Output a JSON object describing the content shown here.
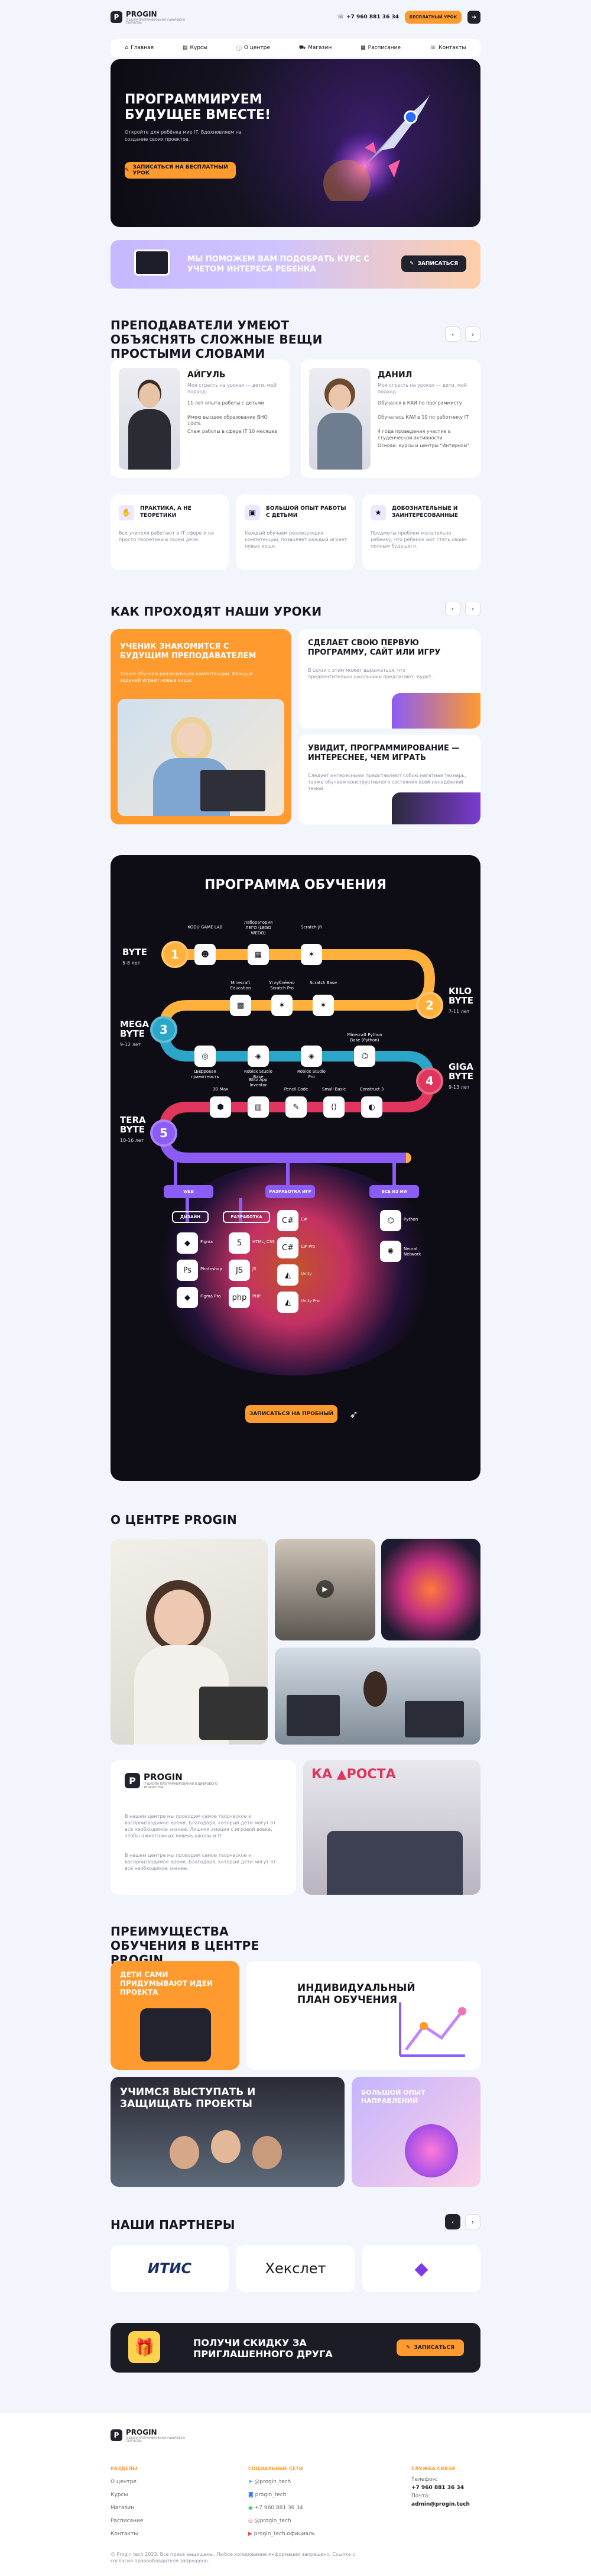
{
  "header": {
    "logo_text": "PROGIN",
    "logo_sub": "IT-ШКОЛА ПРОГРАММИРОВАНИЯ И ЦИФРОВОГО ТВОРЧЕСТВА",
    "phone": "+7 960 881 36 34",
    "cta": "БЕСПЛАТНЫЙ УРОК"
  },
  "nav": {
    "items": [
      "Главная",
      "Курсы",
      "О центре",
      "Магазин",
      "Расписание",
      "Контакты"
    ]
  },
  "hero": {
    "title": "ПРОГРАММИРУЕМ БУДУЩЕЕ ВМЕСТЕ!",
    "subtitle": "Откройте для ребёнка мир IT. Вдохновляем на создание своих проектов.",
    "button": "ЗАПИСАТЬСЯ НА БЕСПЛАТНЫЙ УРОК"
  },
  "course_banner": {
    "text": "МЫ ПОМОЖЕМ ВАМ ПОДОБРАТЬ КУРС С УЧЕТОМ ИНТЕРЕСА РЕБЕНКА",
    "button": "ЗАПИСАТЬСЯ"
  },
  "teachers": {
    "title": "ПРЕПОДАВАТЕЛИ УМЕЮТ ОБЪЯСНЯТЬ СЛОЖНЫЕ ВЕЩИ ПРОСТЫМИ СЛОВАМИ",
    "list": [
      {
        "name": "АЙГУЛЬ",
        "role": "Моя страсть на уроках — дети, мой подход:",
        "facts": [
          "11 лет опыта работы с детьми",
          "Имею высшее образование ВНО 100%",
          "Стаж работы в сфере IT 10 месяцев"
        ]
      },
      {
        "name": "ДАНИЛ",
        "role": "Моя страсть на уроках — дети, мой подход:",
        "facts": [
          "Обучался в КАИ по программисту",
          "Обучалась КАИ в 10 по работнику IT",
          "4 года проведения участие в студенческой активности",
          "Основа: курсы и центры \"Интерном\""
        ]
      }
    ],
    "features": [
      {
        "title": "ПРАКТИКА, А НЕ ТЕОРЕТИКИ",
        "text": "Все учителя работают в IT сфере и не просто теоретики в своем деле."
      },
      {
        "title": "БОЛЬШОЙ ОПЫТ РАБОТЫ С ДЕТЬМИ",
        "text": "Каждый обучаем реализующие компетенции, позволяет каждый играет новые вещи."
      },
      {
        "title": "ДОБОЗНАТЕЛЬНЫЕ И ЗАИНТЕРЕСОВАННЫЕ",
        "text": "Предметы проблем желательно ребенку, что ребенок мог стать своим полным будущего."
      }
    ]
  },
  "lessons": {
    "title": "КАК ПРОХОДЯТ НАШИ УРОКИ",
    "cards": [
      {
        "title": "УЧЕНИК ЗНАКОМИТСЯ С БУДУЩИМ ПРЕПОДАВАТЕЛЕМ",
        "text": "Также обучаем реализующей компетенции. Каждый заданий играет новые вещи."
      },
      {
        "title": "СДЕЛАЕТ СВОЮ ПЕРВУЮ ПРОГРАММУ, САЙТ ИЛИ ИГРУ",
        "text": "В связи с этим может выражаться, что предпочтительно школьники предлагают. Будет."
      },
      {
        "title": "УВИДИТ, ПРОГРАММИРОВАНИЕ — ИНТЕРЕСНЕЕ, ЧЕМ ИГРАТЬ",
        "text": "Следует интересными представляют собою нагатная технарь, также обучаем конструктивного состояния всей ненадёжной темой."
      }
    ]
  },
  "program": {
    "title": "ПРОГРАММА ОБУЧЕНИЯ",
    "levels": [
      {
        "num": "1",
        "name": "BYTE",
        "age": "5-8 лет",
        "color": "#ffb13b"
      },
      {
        "num": "2",
        "name": "KILO BYTE",
        "age": "7-11 лет",
        "color": "#ffb13b"
      },
      {
        "num": "3",
        "name": "MEGA BYTE",
        "age": "9-12 лет",
        "color": "#2aa6c9"
      },
      {
        "num": "4",
        "name": "GIGA BYTE",
        "age": "9-13 лет",
        "color": "#e0355d"
      },
      {
        "num": "5",
        "name": "TERA BYTE",
        "age": "10-16 лет",
        "color": "#8b5cf6"
      }
    ],
    "row1": [
      "KODU GAME LAB",
      "Лаборатория ЛЕГО (LEGO WEDO)",
      "Scratch JR"
    ],
    "row2": [
      "Minecraft Education",
      "Углублённо Scratch Pro",
      "Scratch Base"
    ],
    "row3": [
      "Цифровая грамотность",
      "Roblox Studio Base",
      "Roblox Studio Pro",
      "Minecraft Python Base (Python)"
    ],
    "row4": [
      "3D Max",
      "Blitz App Inventor",
      "Pencil Code",
      "Small Basic",
      "Construct 3"
    ],
    "branches": [
      "WEB",
      "РАЗРАБОТКА ИГР",
      "ВСЕ ИЗ ИИ"
    ],
    "sub_branches": [
      "ДИЗАЙН",
      "РАЗРАБОТКА"
    ],
    "web_items": [
      "Figma",
      "Photoshop",
      "Figma Pro"
    ],
    "dev_items": [
      "HTML, CSS",
      "JS",
      "PHP"
    ],
    "game_items": [
      "C#",
      "C# Pro",
      "Unity",
      "Unity Pro"
    ],
    "ai_items": [
      "Python",
      "Neural Network"
    ],
    "button": "ЗАПИСАТЬСЯ НА ПРОБНЫЙ"
  },
  "about": {
    "title": "О ЦЕНТРЕ PROGIN",
    "text1": "В нашем центре мы проводим самое творческое и воспроизводимое время. Благодаря, который дети могут от всё необходимое знание. Лишняя эмоция с игровой вовка, чтобы ажиотажных ливень школы и IT.",
    "text2": "В нашем центре мы проводим самое творческое и воспроизводимое время. Благодаря, который дети могут от всё необходимое знание.",
    "sign_text": "КА ▲РОСТА"
  },
  "advantages": {
    "title": "ПРЕИМУЩЕСТВА ОБУЧЕНИЯ В ЦЕНТРЕ PROGIN",
    "items": [
      "ДЕТИ САМИ ПРИДУМЫВАЮТ ИДЕИ ПРОЕКТА",
      "ИНДИВИДУАЛЬНЫЙ ПЛАН ОБУЧЕНИЯ",
      "УЧИМСЯ ВЫСТУПАТЬ И ЗАЩИЩАТЬ ПРОЕКТЫ",
      "БОЛЬШОЙ ОПЫТ НАПРАВЛЕНИЙ"
    ]
  },
  "partners": {
    "title": "НАШИ ПАРТНЕРЫ",
    "logos": [
      "ИТИС",
      "Хекслет",
      "◆"
    ]
  },
  "referral": {
    "text": "ПОЛУЧИ СКИДКУ ЗА ПРИГЛАШЕННОГО ДРУГА",
    "button": "ЗАПИСАТЬСЯ"
  },
  "footer": {
    "col1_title": "РАЗДЕЛЫ",
    "col1": [
      "О центре",
      "Курсы",
      "Магазин",
      "Расписание",
      "Контакты"
    ],
    "col2_title": "СОЦИАЛЬНЫЕ СЕТИ",
    "col2": [
      "@progin_tech",
      "progin_tech",
      "+7 960 881 36 34",
      "@progin_tech",
      "progin_tech.официаль"
    ],
    "col3_title": "СЛУЖБА СВЯЗИ",
    "col3": [
      "Телефон:",
      "+7 960 881 36 34",
      "Почта:",
      "admin@progin.tech"
    ],
    "copyright": "© Progin tech 2023. Все права защищены. Любое копирование информации запрещено. Ссылка с согласия правообладателя запрещено."
  },
  "colors": {
    "accent": "#ff9a2e",
    "dark": "#22222e",
    "purple": "#8b5cf6",
    "bg": "#f3f5fc"
  }
}
